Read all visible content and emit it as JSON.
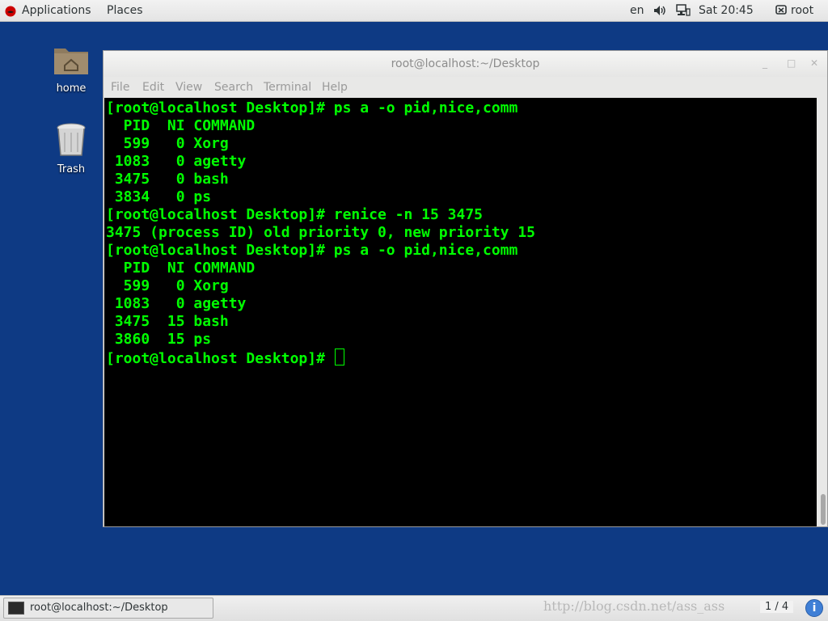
{
  "top_panel": {
    "applications": "Applications",
    "places": "Places",
    "language": "en",
    "clock": "Sat 20:45",
    "user": "root"
  },
  "desktop": {
    "icons": [
      {
        "label": "home",
        "icon": "home-folder-icon"
      },
      {
        "label": "Trash",
        "icon": "trash-icon"
      }
    ]
  },
  "window": {
    "title": "root@localhost:~/Desktop",
    "controls": {
      "minimize": "_",
      "maximize": "□",
      "close": "✕"
    },
    "menu": [
      "File",
      "Edit",
      "View",
      "Search",
      "Terminal",
      "Help"
    ]
  },
  "terminal": {
    "lines": [
      "[root@localhost Desktop]# ps a -o pid,nice,comm",
      "  PID  NI COMMAND",
      "  599   0 Xorg",
      " 1083   0 agetty",
      " 3475   0 bash",
      " 3834   0 ps",
      "[root@localhost Desktop]# renice -n 15 3475",
      "3475 (process ID) old priority 0, new priority 15",
      "[root@localhost Desktop]# ps a -o pid,nice,comm",
      "  PID  NI COMMAND",
      "  599   0 Xorg",
      " 1083   0 agetty",
      " 3475  15 bash",
      " 3860  15 ps"
    ],
    "prompt": "[root@localhost Desktop]# ",
    "text_color": "#00ff00",
    "background": "#000000"
  },
  "bottom_panel": {
    "task_label": "root@localhost:~/Desktop",
    "watermark": "http://blog.csdn.net/ass_ass",
    "workspace": "1 / 4",
    "info": "i"
  }
}
